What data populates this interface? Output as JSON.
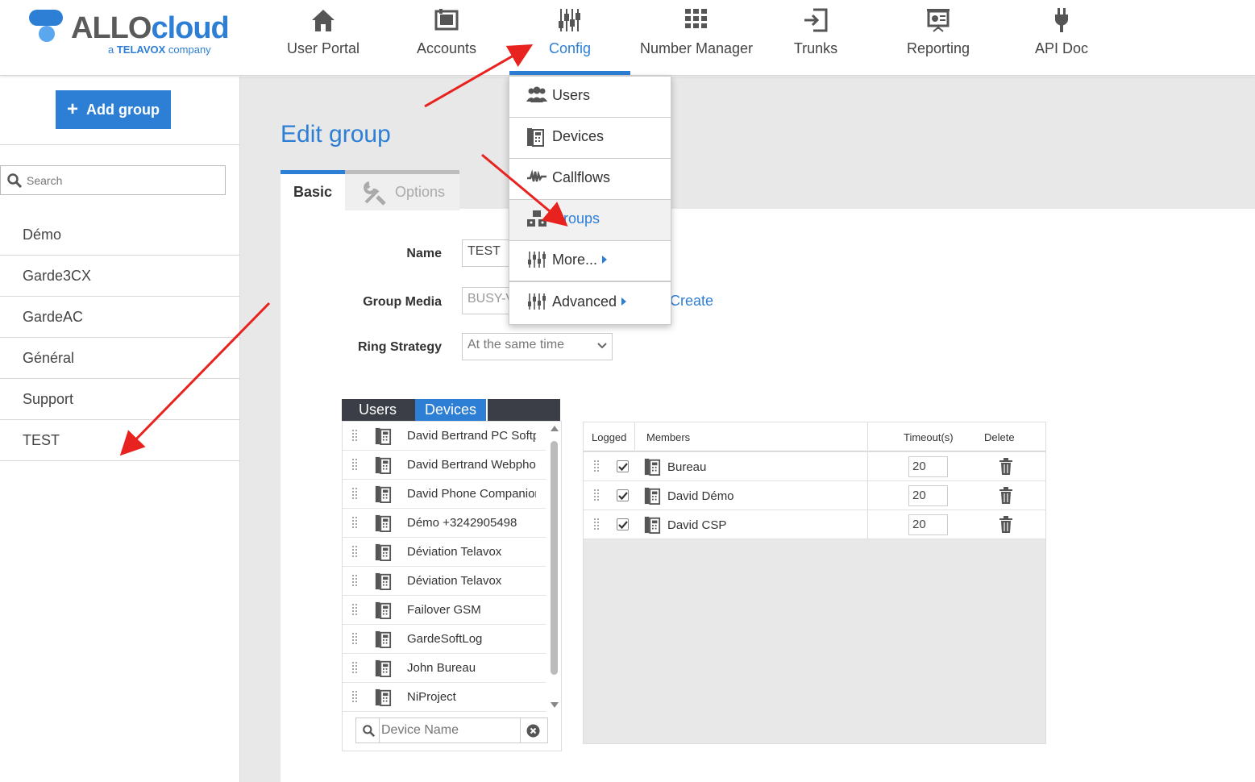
{
  "brand": {
    "name_part1": "ALLO",
    "name_part2": "cloud",
    "tagline_prefix": "a",
    "tagline_brand": "TELAVOX",
    "tagline_suffix": "company"
  },
  "colors": {
    "accent": "#2d7fd6",
    "annotation": "#e8221e",
    "dark_tab": "#3b3e46",
    "panel_bg": "#e8e8e8"
  },
  "nav": {
    "items": [
      {
        "label": "User Portal",
        "icon": "home-icon"
      },
      {
        "label": "Accounts",
        "icon": "accounts-icon"
      },
      {
        "label": "Config",
        "icon": "sliders-icon",
        "active": true
      },
      {
        "label": "Number Manager",
        "icon": "keypad-icon"
      },
      {
        "label": "Trunks",
        "icon": "trunk-login-icon"
      },
      {
        "label": "Reporting",
        "icon": "presentation-icon"
      },
      {
        "label": "API Doc",
        "icon": "plug-icon"
      }
    ]
  },
  "config_menu": {
    "items": [
      {
        "label": "Users",
        "icon": "users-icon"
      },
      {
        "label": "Devices",
        "icon": "desk-phone-icon"
      },
      {
        "label": "Callflows",
        "icon": "waveform-icon"
      },
      {
        "label": "Groups",
        "icon": "groups-icon",
        "highlighted": true
      },
      {
        "label": "More...",
        "icon": "sliders-icon",
        "submenu": true
      },
      {
        "label": "Advanced",
        "icon": "sliders-icon",
        "submenu": true
      }
    ]
  },
  "sidebar": {
    "add_button": "Add group",
    "search_placeholder": "Search",
    "groups": [
      "Démo",
      "Garde3CX",
      "GardeAC",
      "Général",
      "Support",
      "TEST"
    ]
  },
  "main": {
    "title": "Edit group",
    "tabs": {
      "basic": "Basic",
      "options": "Options"
    },
    "form": {
      "name_label": "Name",
      "name_value": "TEST",
      "media_label": "Group Media",
      "media_value": "BUSY-V",
      "create_link": "Create",
      "ring_label": "Ring Strategy",
      "ring_value": "At the same time"
    },
    "source": {
      "tab_users": "Users",
      "tab_devices": "Devices",
      "devices": [
        "David Bertrand PC Softphone",
        "David Bertrand Webphone",
        "David Phone Companion",
        "Démo +3242905498",
        "Déviation Telavox",
        "Déviation Telavox",
        "Failover GSM",
        "GardeSoftLog",
        "John Bureau",
        "NiProject"
      ],
      "search_placeholder": "Device Name"
    },
    "members": {
      "headers": {
        "logged": "Logged",
        "members": "Members",
        "timeout": "Timeout(s)",
        "delete": "Delete"
      },
      "rows": [
        {
          "name": "Bureau",
          "logged": true,
          "timeout": "20"
        },
        {
          "name": "David Démo",
          "logged": true,
          "timeout": "20"
        },
        {
          "name": "David CSP",
          "logged": true,
          "timeout": "20"
        }
      ]
    }
  }
}
